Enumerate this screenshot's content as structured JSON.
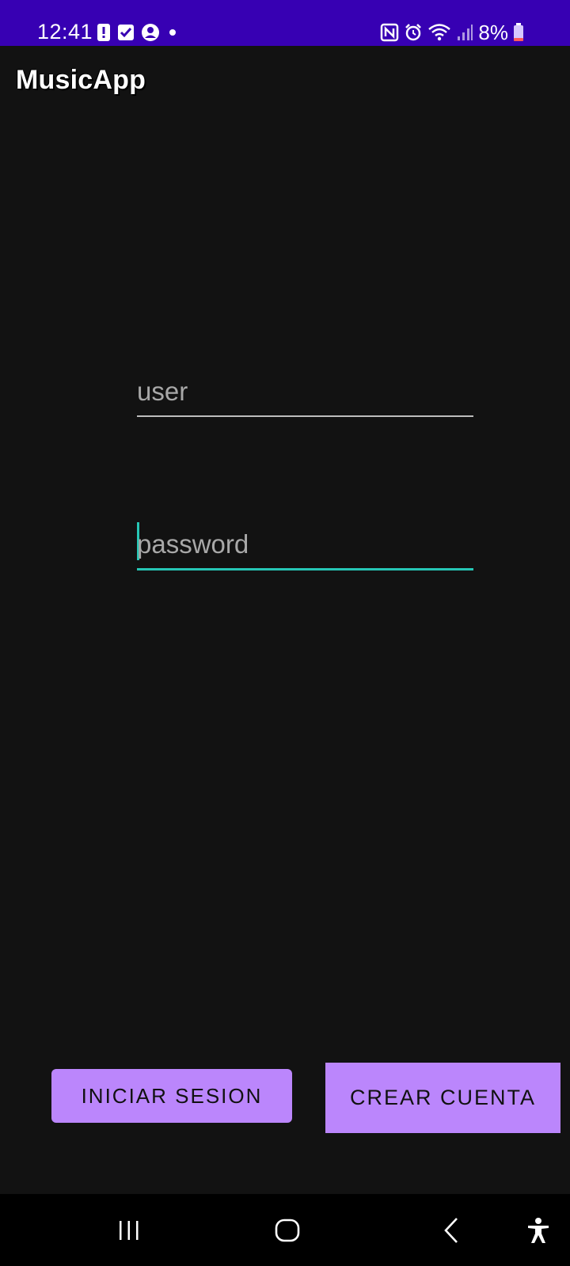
{
  "status_bar": {
    "time": "12:41",
    "left_icons": [
      "alert-icon",
      "checkbox-icon",
      "account-icon",
      "dot-icon"
    ],
    "right_icons": [
      "nfc-icon",
      "alarm-icon",
      "wifi-icon",
      "signal-icon",
      "battery-icon"
    ],
    "battery": "8%",
    "background": "#3700B3"
  },
  "app_bar": {
    "title": "MusicApp"
  },
  "form": {
    "user": {
      "placeholder": "user",
      "value": ""
    },
    "password": {
      "placeholder": "password",
      "value": "",
      "focused": true
    }
  },
  "buttons": {
    "login_label": "INICIAR SESION",
    "create_label": "CREAR CUENTA",
    "color": "#BB86FC"
  },
  "accent_color": "#26C6B5",
  "nav_bar": {
    "items": [
      "recents-icon",
      "home-icon",
      "back-icon",
      "accessibility-icon"
    ]
  }
}
